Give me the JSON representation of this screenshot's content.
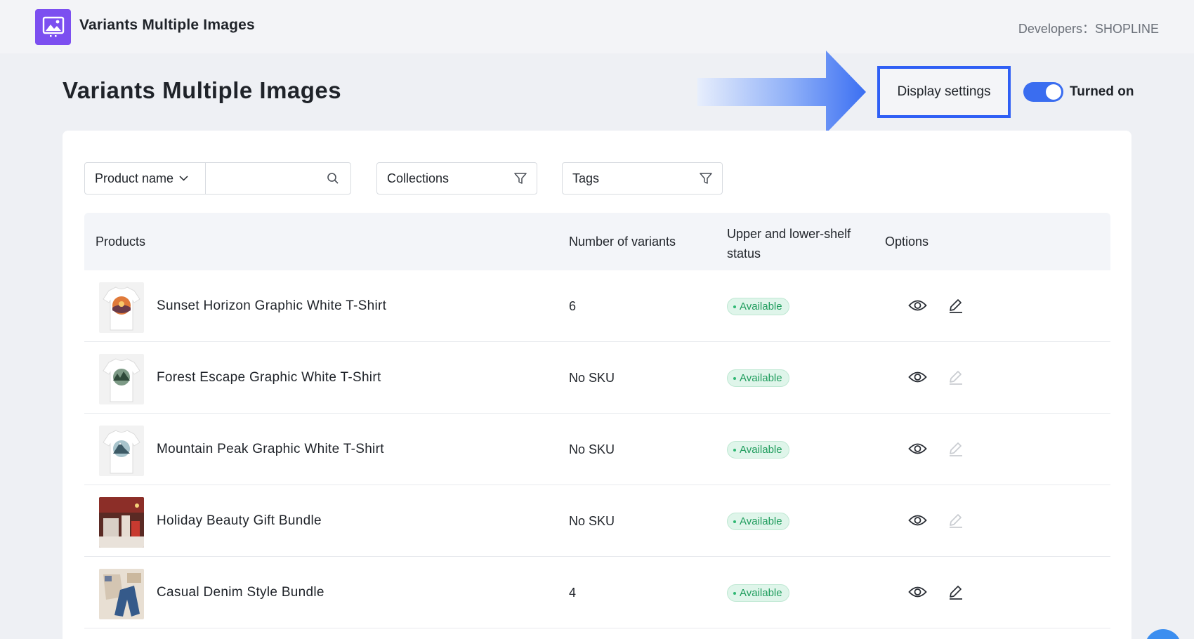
{
  "app": {
    "name": "Variants Multiple Images",
    "developers_label": "Developers：",
    "developers_value": "SHOPLINE"
  },
  "header": {
    "title": "Variants Multiple Images",
    "display_settings_label": "Display settings",
    "toggle_label": "Turned on",
    "toggle_on": true
  },
  "filters": {
    "field_select": "Product name",
    "search_placeholder": "",
    "collections_label": "Collections",
    "tags_label": "Tags"
  },
  "table": {
    "columns": {
      "products": "Products",
      "variants": "Number of variants",
      "status": "Upper and lower-shelf status",
      "options": "Options"
    },
    "rows": [
      {
        "name": "Sunset Horizon Graphic White T-Shirt",
        "variants": "6",
        "status": "Available",
        "editable": true,
        "thumb": "sunset-tshirt"
      },
      {
        "name": "Forest Escape Graphic White T-Shirt",
        "variants": "No SKU",
        "status": "Available",
        "editable": false,
        "thumb": "forest-tshirt"
      },
      {
        "name": "Mountain Peak Graphic White T-Shirt",
        "variants": "No SKU",
        "status": "Available",
        "editable": false,
        "thumb": "mountain-tshirt"
      },
      {
        "name": "Holiday Beauty Gift Bundle",
        "variants": "No SKU",
        "status": "Available",
        "editable": false,
        "thumb": "holiday-bundle"
      },
      {
        "name": "Casual Denim Style Bundle",
        "variants": "4",
        "status": "Available",
        "editable": true,
        "thumb": "denim-bundle"
      }
    ]
  },
  "colors": {
    "accent": "#2f5ff5",
    "toggle": "#3a6df0",
    "logo": "#7c4ff0",
    "available_text": "#1e9c5c",
    "available_bg": "#dff5ea"
  },
  "icons": [
    "app-logo-icon",
    "chevron-down-icon",
    "search-icon",
    "filter-icon",
    "eye-icon",
    "edit-icon",
    "arrow-icon"
  ]
}
